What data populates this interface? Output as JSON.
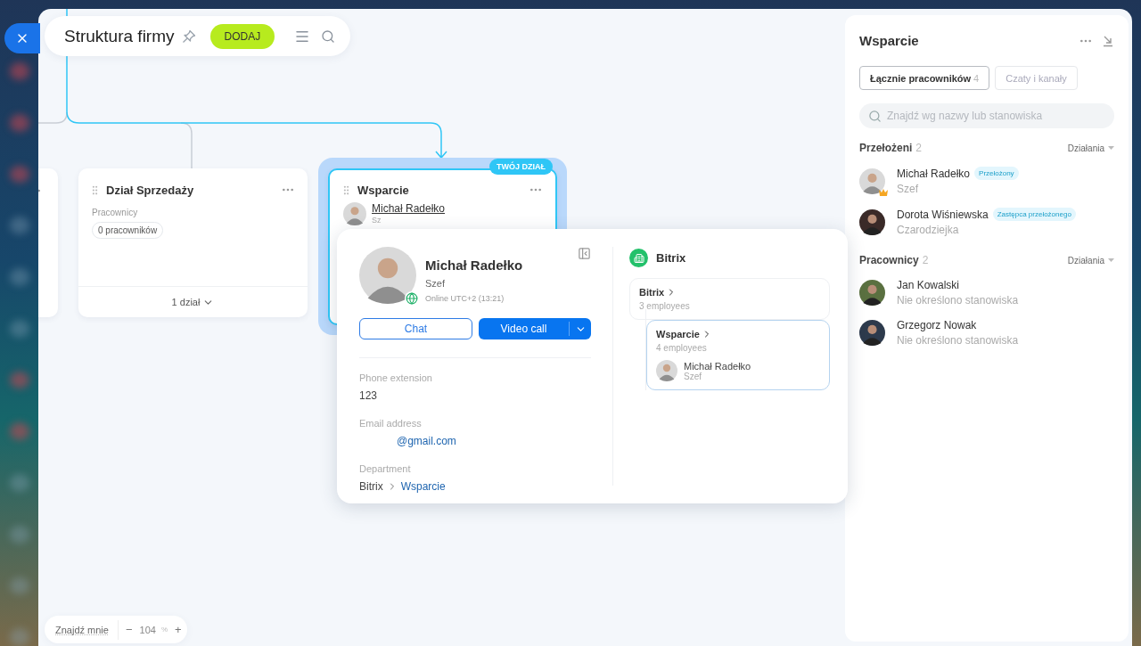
{
  "header": {
    "title": "Struktura firmy",
    "add_button": "DODAJ"
  },
  "departments": [
    {
      "title": "Dział Sprzedaży",
      "highlighted": false,
      "section_label": "Pracownicy",
      "employee_count": "0 pracowników",
      "footer": "1 dział"
    },
    {
      "title": "Wsparcie",
      "highlighted": true,
      "badge": "TWÓJ DZIAŁ",
      "head_name": "Michał Radełko",
      "head_role": "Sz"
    }
  ],
  "popup": {
    "name": "Michał Radełko",
    "role": "Szef",
    "status": "Online UTC+2 (13:21)",
    "chat_button": "Chat",
    "video_button": "Video call",
    "fields": [
      {
        "label": "Phone extension",
        "value": "123",
        "kind": "text"
      },
      {
        "label": "Email address",
        "value": "@gmail.com",
        "kind": "link"
      }
    ],
    "department": {
      "label": "Department",
      "path": [
        {
          "label": "Bitrix",
          "kind": "text"
        },
        {
          "label": "Wsparcie",
          "kind": "link"
        }
      ]
    },
    "org_title": "Bitrix",
    "tree": [
      {
        "name": "Bitrix",
        "count": "3 employees",
        "selected": false,
        "children": [
          {
            "name": "Wsparcie",
            "count": "4 employees",
            "selected": true,
            "head": {
              "name": "Michał Radełko",
              "role": "Szef"
            }
          }
        ]
      }
    ]
  },
  "panel": {
    "title": "Wsparcie",
    "tabs": [
      {
        "label": "Łącznie pracowników",
        "count": "4",
        "selected": true
      },
      {
        "label": "Czaty i kanały",
        "selected": false
      }
    ],
    "search": {
      "placeholder": "Znajdź wg nazwy lub stanowiska"
    },
    "sections": [
      {
        "title": "Przełożeni",
        "count": "2",
        "action": "Działania",
        "people": [
          {
            "name": "Michał Radełko",
            "role": "Szef",
            "tag": "Przełożony",
            "head": true
          },
          {
            "name": "Dorota Wiśniewska",
            "role": "Czarodziejka",
            "tag": "Zastępca przełożonego",
            "head": false
          }
        ]
      },
      {
        "title": "Pracownicy",
        "count": "2",
        "action": "Działania",
        "people": [
          {
            "name": "Jan Kowalski",
            "role": "Nie określono stanowiska",
            "head": false
          },
          {
            "name": "Grzegorz Nowak",
            "role": "Nie określono stanowiska",
            "head": false
          }
        ]
      }
    ]
  },
  "zoom": {
    "find_me": "Znajdź mnie",
    "minus": "−",
    "value": "104",
    "unit": "%",
    "plus": "+"
  }
}
